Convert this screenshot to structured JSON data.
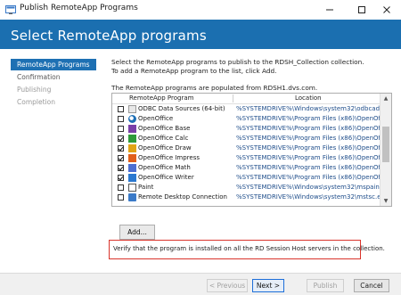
{
  "window": {
    "title": "Publish RemoteApp Programs",
    "minimize_icon": "minimize-icon",
    "maximize_icon": "maximize-icon",
    "close_icon": "close-icon"
  },
  "header": {
    "title": "Select RemoteApp programs",
    "color": "#1b6fb0"
  },
  "nav": [
    {
      "label": "RemoteApp Programs",
      "state": "selected"
    },
    {
      "label": "Confirmation",
      "state": "normal"
    },
    {
      "label": "Publishing",
      "state": "disabled"
    },
    {
      "label": "Completion",
      "state": "disabled"
    }
  ],
  "content": {
    "intro": "Select the RemoteApp programs to publish to the RDSH_Collection collection. To add a RemoteApp program to the list, click Add.",
    "populated_text": "The RemoteApp programs are populated from RDSH1.dvs.com.",
    "table": {
      "columns": [
        "RemoteApp Program",
        "Location"
      ],
      "rows": [
        {
          "checked": false,
          "icon": "odbc-icon",
          "name": "ODBC Data Sources (64-bit)",
          "location": "%SYSTEMDRIVE%\\Windows\\system32\\odbcad32.exe"
        },
        {
          "checked": false,
          "icon": "openoffice-icon",
          "name": "OpenOffice",
          "location": "%SYSTEMDRIVE%\\Program Files (x86)\\OpenOffice 4\\program"
        },
        {
          "checked": false,
          "icon": "openoffice-base-icon",
          "name": "OpenOffice Base",
          "location": "%SYSTEMDRIVE%\\Program Files (x86)\\OpenOffice 4\\program"
        },
        {
          "checked": true,
          "icon": "openoffice-calc-icon",
          "name": "OpenOffice Calc",
          "location": "%SYSTEMDRIVE%\\Program Files (x86)\\OpenOffice 4\\program"
        },
        {
          "checked": true,
          "icon": "openoffice-draw-icon",
          "name": "OpenOffice Draw",
          "location": "%SYSTEMDRIVE%\\Program Files (x86)\\OpenOffice 4\\program"
        },
        {
          "checked": true,
          "icon": "openoffice-impress-icon",
          "name": "OpenOffice Impress",
          "location": "%SYSTEMDRIVE%\\Program Files (x86)\\OpenOffice 4\\program"
        },
        {
          "checked": true,
          "icon": "openoffice-math-icon",
          "name": "OpenOffice Math",
          "location": "%SYSTEMDRIVE%\\Program Files (x86)\\OpenOffice 4\\program"
        },
        {
          "checked": true,
          "icon": "openoffice-writer-icon",
          "name": "OpenOffice Writer",
          "location": "%SYSTEMDRIVE%\\Program Files (x86)\\OpenOffice 4\\program"
        },
        {
          "checked": false,
          "icon": "paint-icon",
          "name": "Paint",
          "location": "%SYSTEMDRIVE%\\Windows\\system32\\mspaint.exe"
        },
        {
          "checked": false,
          "icon": "remote-desktop-icon",
          "name": "Remote Desktop Connection",
          "location": "%SYSTEMDRIVE%\\Windows\\system32\\mstsc.exe"
        }
      ]
    },
    "add_label": "Add...",
    "verify_text": "Verify that the program is installed on all the RD Session Host servers in the collection.",
    "verify_border_color": "#d9342b"
  },
  "footer": {
    "previous_label": "< Previous",
    "next_label": "Next >",
    "publish_label": "Publish",
    "cancel_label": "Cancel"
  }
}
